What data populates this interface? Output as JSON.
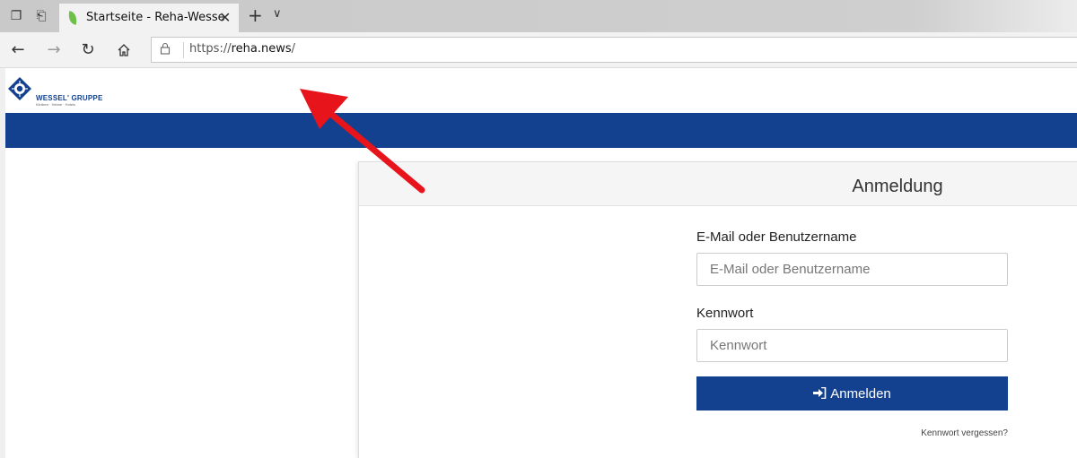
{
  "browser": {
    "tab_title": "Startseite - Reha-Wesse",
    "url_prefix": "https://",
    "url_host": "reha.news",
    "url_suffix": "/"
  },
  "brand": {
    "name": "WESSEL' GRUPPE",
    "tagline": "Kliniken · Heime · Hotels",
    "primary_color": "#13418f"
  },
  "login": {
    "title": "Anmeldung",
    "email_label": "E-Mail oder Benutzername",
    "email_placeholder": "E-Mail oder Benutzername",
    "password_label": "Kennwort",
    "password_placeholder": "Kennwort",
    "submit_label": "Anmelden",
    "forgot_link": "Kennwort vergessen?"
  },
  "annotation": {
    "arrow_color": "#e8141b"
  }
}
